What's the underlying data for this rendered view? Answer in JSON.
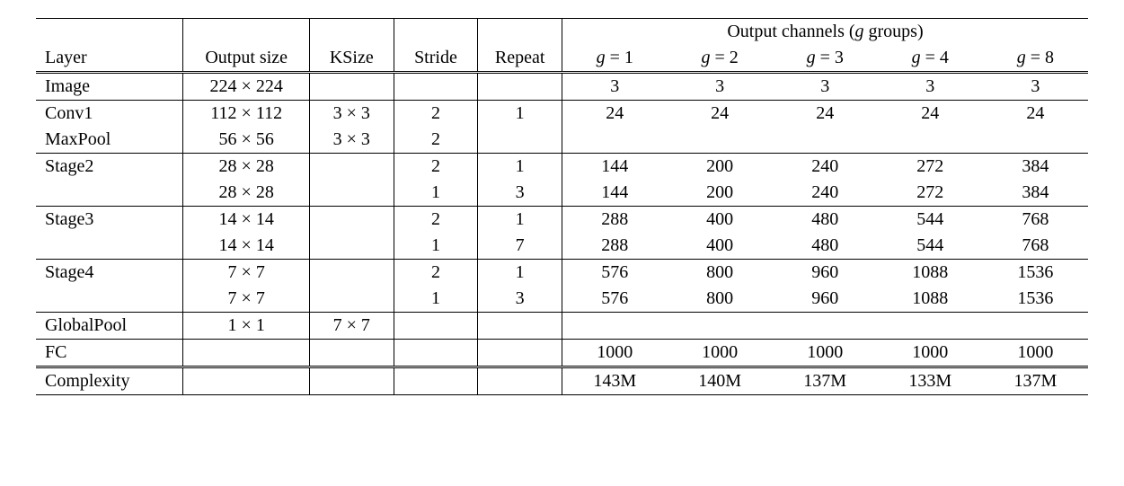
{
  "chart_data": {
    "type": "table",
    "title": "",
    "columns": [
      "Layer",
      "Output size",
      "KSize",
      "Stride",
      "Repeat",
      "g=1",
      "g=2",
      "g=3",
      "g=4",
      "g=8"
    ],
    "group_header": "Output channels (g groups)",
    "rows": [
      {
        "layer": "Image",
        "output": "224 × 224",
        "ksize": "",
        "stride": "",
        "repeat": "",
        "g1": "3",
        "g2": "3",
        "g3": "3",
        "g4": "3",
        "g8": "3"
      },
      {
        "layer": "Conv1",
        "output": "112 × 112",
        "ksize": "3 × 3",
        "stride": "2",
        "repeat": "1",
        "g1": "24",
        "g2": "24",
        "g3": "24",
        "g4": "24",
        "g8": "24"
      },
      {
        "layer": "MaxPool",
        "output": "56 × 56",
        "ksize": "3 × 3",
        "stride": "2",
        "repeat": "",
        "g1": "",
        "g2": "",
        "g3": "",
        "g4": "",
        "g8": ""
      },
      {
        "layer": "Stage2",
        "output": "28 × 28",
        "ksize": "",
        "stride": "2",
        "repeat": "1",
        "g1": "144",
        "g2": "200",
        "g3": "240",
        "g4": "272",
        "g8": "384"
      },
      {
        "layer": "",
        "output": "28 × 28",
        "ksize": "",
        "stride": "1",
        "repeat": "3",
        "g1": "144",
        "g2": "200",
        "g3": "240",
        "g4": "272",
        "g8": "384"
      },
      {
        "layer": "Stage3",
        "output": "14 × 14",
        "ksize": "",
        "stride": "2",
        "repeat": "1",
        "g1": "288",
        "g2": "400",
        "g3": "480",
        "g4": "544",
        "g8": "768"
      },
      {
        "layer": "",
        "output": "14 × 14",
        "ksize": "",
        "stride": "1",
        "repeat": "7",
        "g1": "288",
        "g2": "400",
        "g3": "480",
        "g4": "544",
        "g8": "768"
      },
      {
        "layer": "Stage4",
        "output": "7 × 7",
        "ksize": "",
        "stride": "2",
        "repeat": "1",
        "g1": "576",
        "g2": "800",
        "g3": "960",
        "g4": "1088",
        "g8": "1536"
      },
      {
        "layer": "",
        "output": "7 × 7",
        "ksize": "",
        "stride": "1",
        "repeat": "3",
        "g1": "576",
        "g2": "800",
        "g3": "960",
        "g4": "1088",
        "g8": "1536"
      },
      {
        "layer": "GlobalPool",
        "output": "1 × 1",
        "ksize": "7 × 7",
        "stride": "",
        "repeat": "",
        "g1": "",
        "g2": "",
        "g3": "",
        "g4": "",
        "g8": ""
      },
      {
        "layer": "FC",
        "output": "",
        "ksize": "",
        "stride": "",
        "repeat": "",
        "g1": "1000",
        "g2": "1000",
        "g3": "1000",
        "g4": "1000",
        "g8": "1000"
      },
      {
        "layer": "Complexity",
        "output": "",
        "ksize": "",
        "stride": "",
        "repeat": "",
        "g1": "143M",
        "g2": "140M",
        "g3": "137M",
        "g4": "133M",
        "g8": "137M"
      }
    ]
  },
  "header": {
    "layer": "Layer",
    "output": "Output size",
    "ksize": "KSize",
    "stride": "Stride",
    "repeat": "Repeat",
    "groups_title_pre": "Output channels (",
    "groups_title_var": "g",
    "groups_title_post": " groups)",
    "g1_pre": "g",
    "g1_eq": " = 1",
    "g2_pre": "g",
    "g2_eq": " = 2",
    "g3_pre": "g",
    "g3_eq": " = 3",
    "g4_pre": "g",
    "g4_eq": " = 4",
    "g8_pre": "g",
    "g8_eq": " = 8"
  }
}
